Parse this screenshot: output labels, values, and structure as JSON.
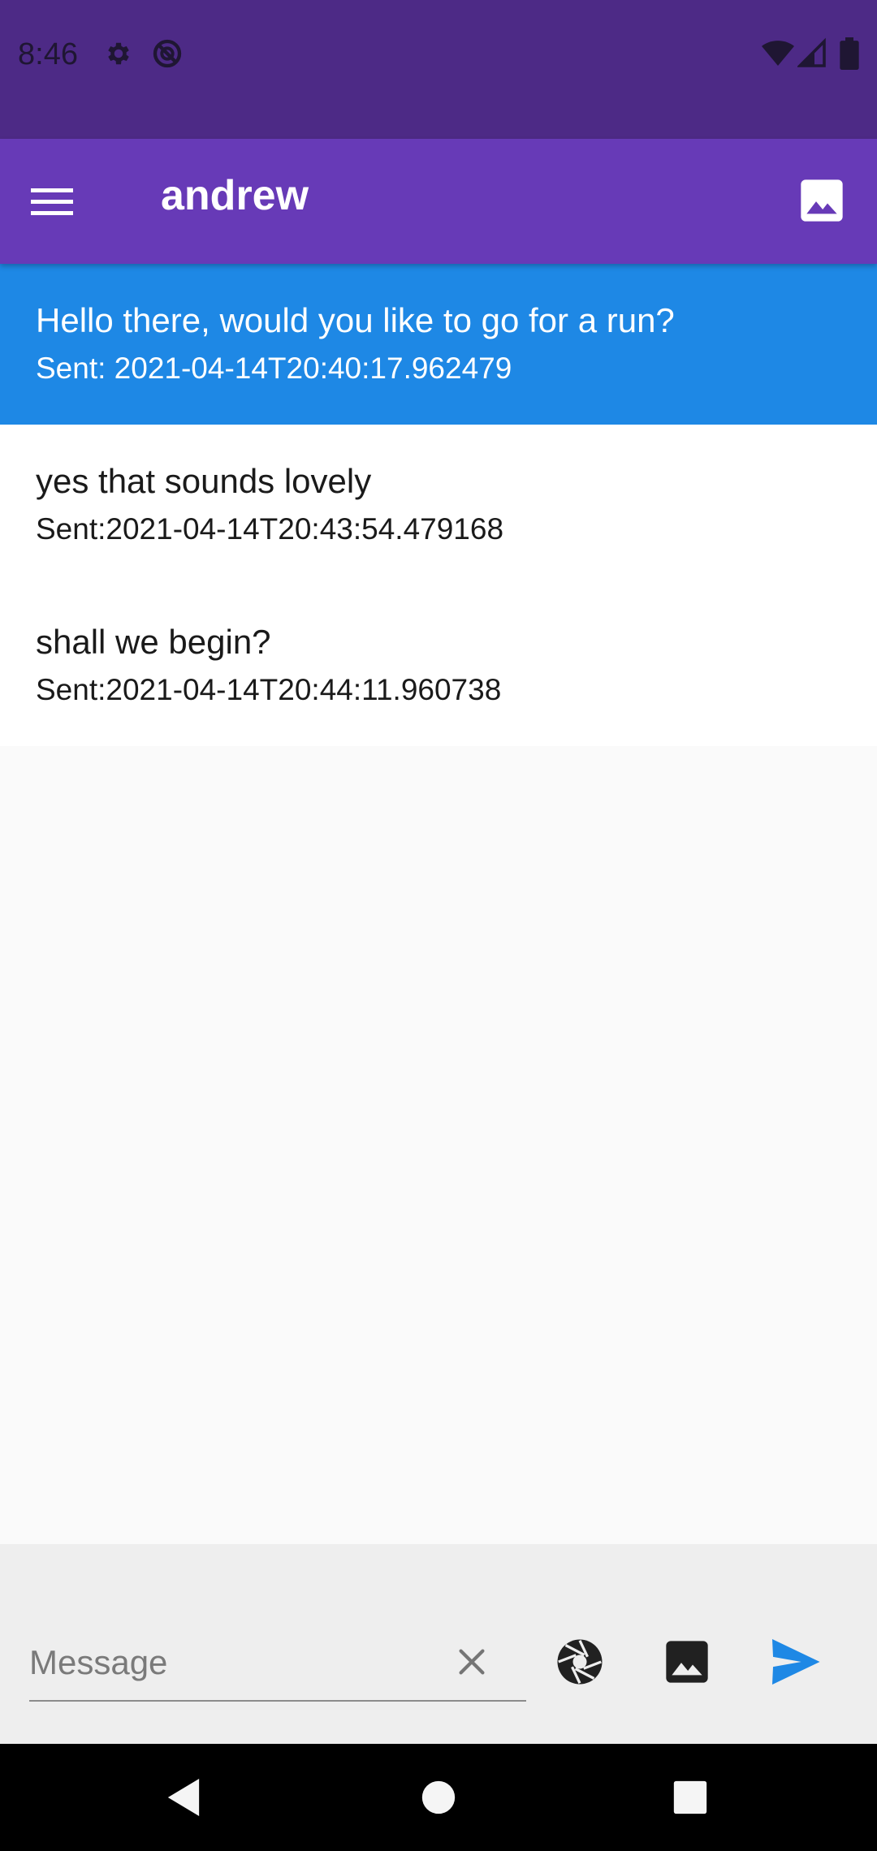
{
  "status_bar": {
    "time": "8:46",
    "icons": [
      "gear-icon",
      "do-not-disturb-icon",
      "wifi-icon",
      "signal-icon",
      "battery-icon"
    ]
  },
  "app_bar": {
    "title": "andrew",
    "background": "#673ab7",
    "actions": [
      "menu-icon",
      "image-icon"
    ]
  },
  "messages": [
    {
      "text": "Hello there, would you like to go for a run?",
      "sent": "Sent: 2021-04-14T20:40:17.962479",
      "selected": true
    },
    {
      "text": "yes that sounds lovely",
      "sent": "Sent:2021-04-14T20:43:54.479168",
      "selected": false
    },
    {
      "text": "shall we begin?",
      "sent": "Sent:2021-04-14T20:44:11.960738",
      "selected": false
    }
  ],
  "composer": {
    "placeholder": "Message",
    "value": "",
    "buttons": [
      "clear-icon",
      "camera-shutter-icon",
      "image-icon",
      "send-icon"
    ],
    "accent": "#1e88e5"
  },
  "nav_bar": {
    "buttons": [
      "back-icon",
      "home-icon",
      "recents-icon"
    ]
  }
}
